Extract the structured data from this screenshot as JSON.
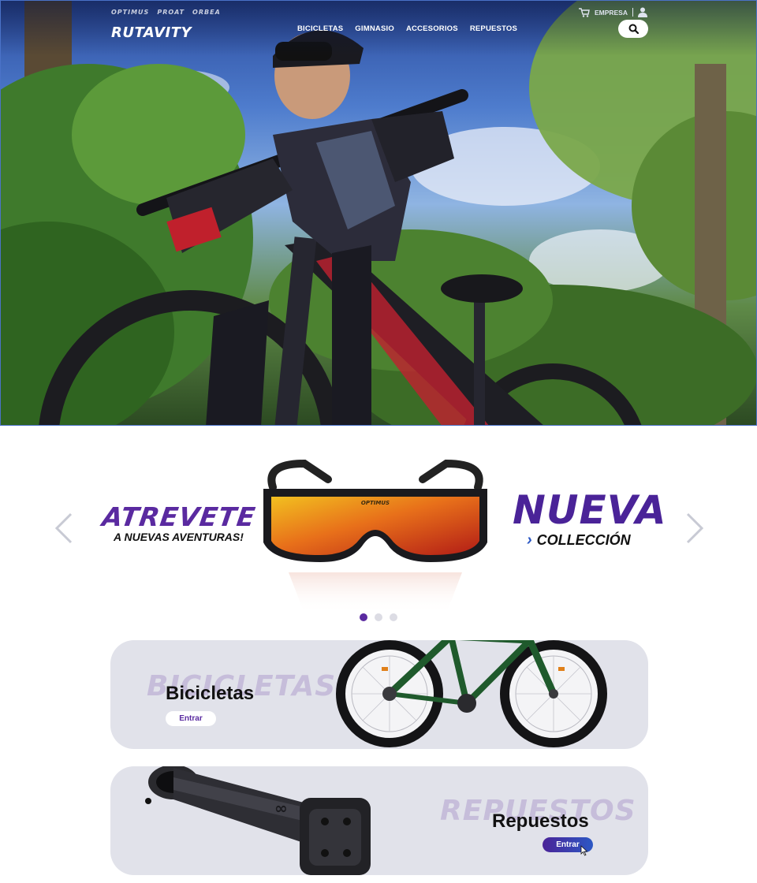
{
  "header": {
    "partner_brands": [
      "OPTIMUS",
      "PROAT",
      "ORBEA"
    ],
    "logo": "RUTAVITY",
    "nav": [
      "BICICLETAS",
      "GIMNASIO",
      "ACCESORIOS",
      "REPUESTOS"
    ],
    "empresa_label": "EMPRESA",
    "icons": {
      "cart": "cart-icon",
      "user": "user-icon",
      "search": "search-icon"
    }
  },
  "carousel": {
    "left_big": "ATREVETE",
    "left_small": "A NUEVAS AVENTURAS!",
    "right_big": "NUEVA",
    "right_small": "COLLECCIÓN",
    "glasses_brand": "OPTIMUS",
    "slide_count": 3,
    "active_slide": 1
  },
  "categories": [
    {
      "ghost": "BICICLETAS",
      "title": "Bicicletas",
      "button": "Entrar"
    },
    {
      "ghost": "REPUESTOS",
      "title": "Repuestos",
      "button": "Entrar"
    }
  ],
  "colors": {
    "purple": "#5a2aa0",
    "blue": "#2c58c4",
    "card_bg": "#e1e2ea"
  }
}
